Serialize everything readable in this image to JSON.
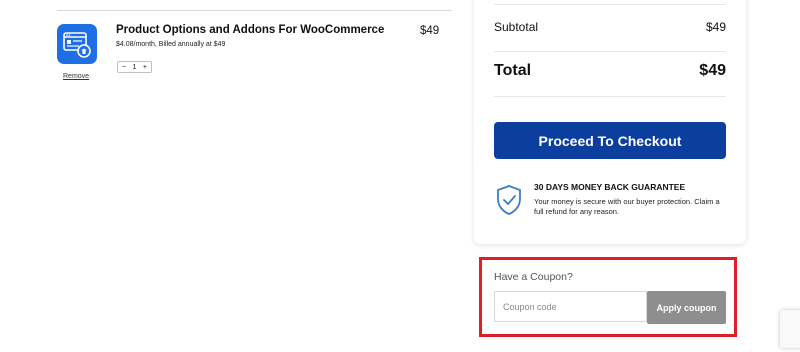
{
  "cart": {
    "item": {
      "name": "Product Options and Addons For WooCommerce",
      "billing": "$4.08/month, Billed annually at $49",
      "price": "$49",
      "remove_label": "Remove",
      "quantity": {
        "decrement": "−",
        "value": "1",
        "increment": "+"
      }
    }
  },
  "summary": {
    "subtotal_label": "Subtotal",
    "subtotal_value": "$49",
    "total_label": "Total",
    "total_value": "$49",
    "checkout_label": "Proceed To Checkout",
    "guarantee_title": "30 DAYS MONEY BACK GUARANTEE",
    "guarantee_text": "Your money is secure with our buyer protection. Claim a full refund for any reason."
  },
  "coupon": {
    "label": "Have a Coupon?",
    "placeholder": "Coupon code",
    "apply_label": "Apply coupon"
  },
  "colors": {
    "checkout_button": "#0c3f9d",
    "highlight_border": "#e11d2a",
    "apply_button": "#8e8e8e",
    "product_icon_bg": "#1e6fe6"
  }
}
